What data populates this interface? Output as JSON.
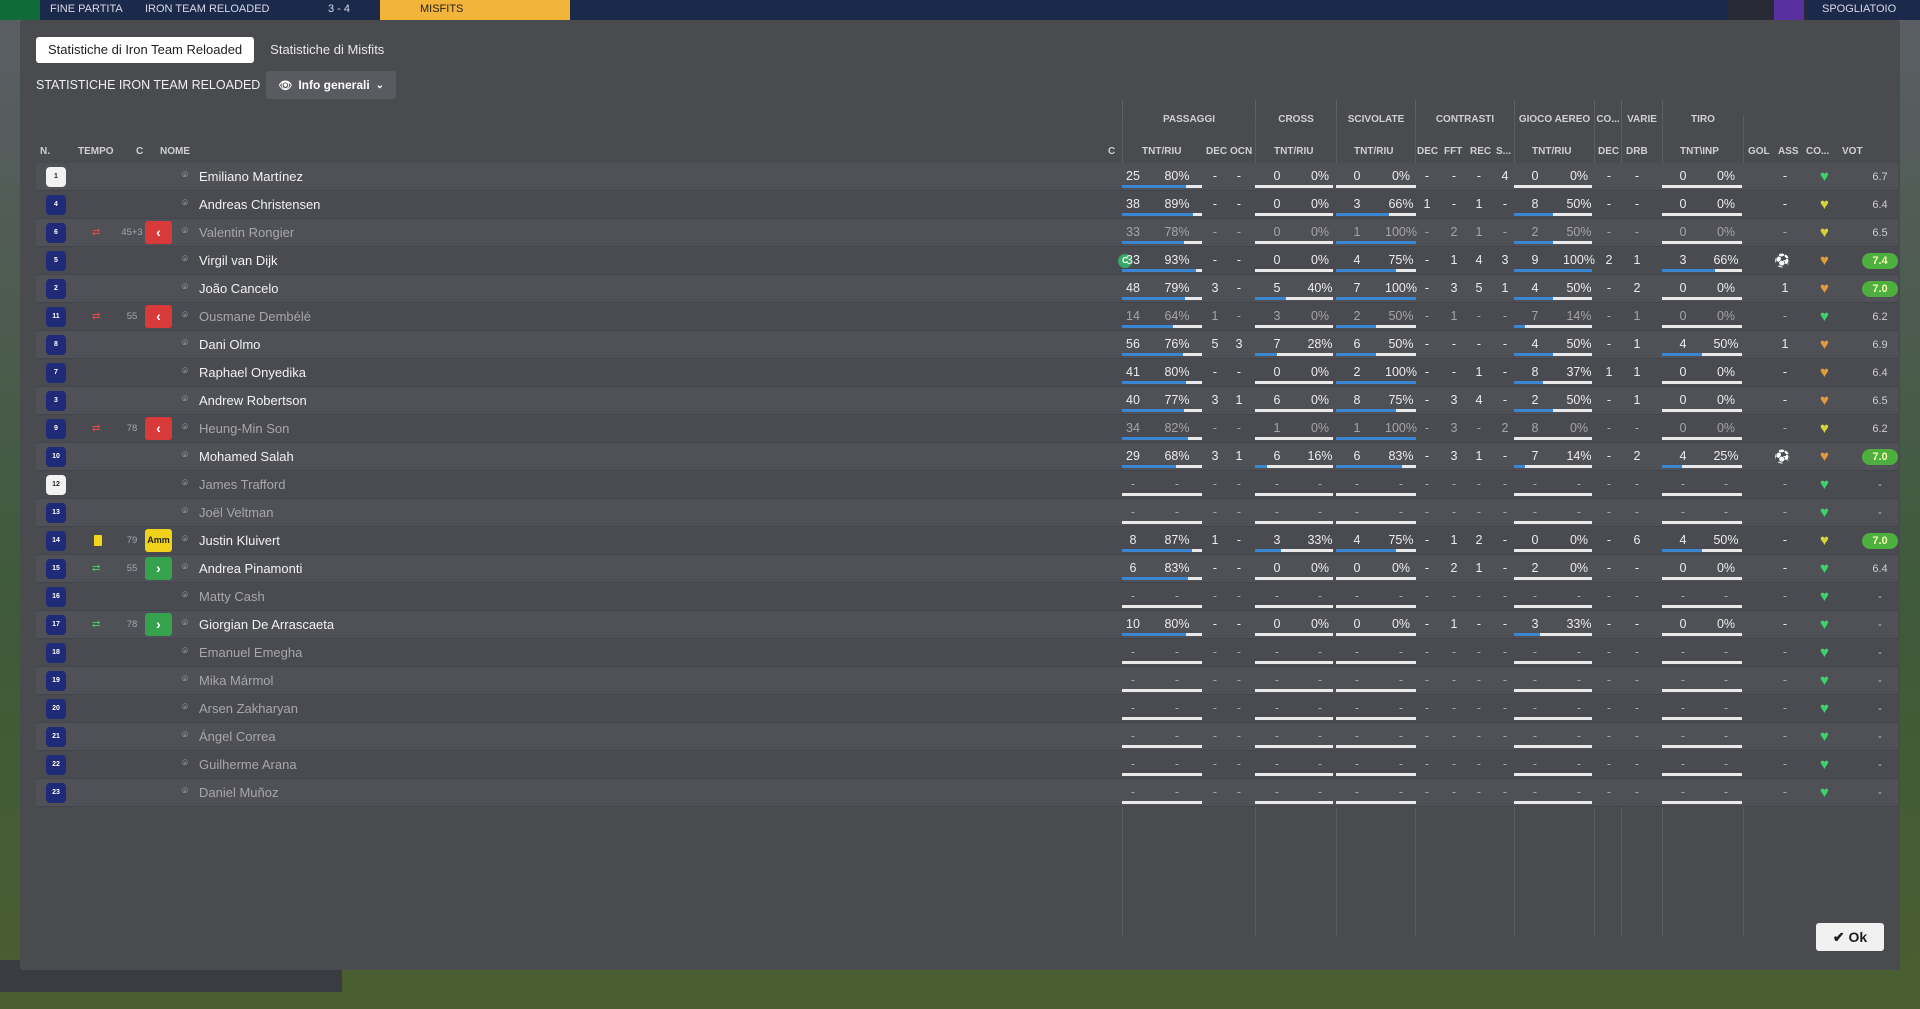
{
  "topbar": {
    "items": [
      "FINE PARTITA",
      "IRON TEAM RELOADED",
      "3 - 4",
      "MISFITS",
      "SPOGLIATOIO"
    ]
  },
  "tabs": [
    {
      "label": "Statistiche di Iron Team Reloaded",
      "active": true
    },
    {
      "label": "Statistiche di Misfits",
      "active": false
    }
  ],
  "subheader": {
    "title": "STATISTICHE IRON TEAM RELOADED",
    "view_label": "Info generali"
  },
  "groups": [
    "PASSAGGI",
    "CROSS",
    "SCIVOLATE",
    "CONTRASTI",
    "GIOCO AEREO",
    "CO...",
    "VARIE",
    "TIRO"
  ],
  "columns": {
    "n": "N.",
    "tempo": "TEMPO",
    "c": "C",
    "nome": "NOME",
    "capt": "C",
    "pass_tr": "TNT/RIU",
    "pass_dec": "DEC",
    "pass_ocn": "OCN",
    "cross_tr": "TNT/RIU",
    "tack_tr": "TNT/RIU",
    "con_dec": "DEC",
    "con_fft": "FFT",
    "con_rec": "REC",
    "con_s": "S...",
    "air_tr": "TNT/RIU",
    "co_dec": "DEC",
    "var_drb": "DRB",
    "shot_tr": "TNT\\INP",
    "gol": "GOL",
    "ass": "ASS",
    "cond": "CO...",
    "vot": "VOT"
  },
  "players": [
    {
      "n": "1",
      "gk": true,
      "name": "Emiliano Martínez",
      "sub": "",
      "tempo": "",
      "cbadge": "",
      "capt": false,
      "muted": false,
      "pass": [
        "25",
        "80%"
      ],
      "pass_dec": "-",
      "pass_ocn": "-",
      "cross": [
        "0",
        "0%"
      ],
      "tack": [
        "0",
        "0%"
      ],
      "con": [
        "-",
        "-",
        "-",
        "4"
      ],
      "air": [
        "0",
        "0%"
      ],
      "co_dec": "-",
      "drb": "-",
      "shot": [
        "0",
        "0%"
      ],
      "gol": "",
      "ass": "-",
      "cond": "green",
      "vot": "6.7",
      "vot_good": false
    },
    {
      "n": "4",
      "gk": false,
      "name": "Andreas Christensen",
      "sub": "",
      "tempo": "",
      "cbadge": "",
      "capt": false,
      "muted": false,
      "pass": [
        "38",
        "89%"
      ],
      "pass_dec": "-",
      "pass_ocn": "-",
      "cross": [
        "0",
        "0%"
      ],
      "tack": [
        "3",
        "66%"
      ],
      "con": [
        "1",
        "-",
        "1",
        "-"
      ],
      "air": [
        "8",
        "50%"
      ],
      "co_dec": "-",
      "drb": "-",
      "shot": [
        "0",
        "0%"
      ],
      "gol": "",
      "ass": "-",
      "cond": "yellow",
      "vot": "6.4",
      "vot_good": false
    },
    {
      "n": "6",
      "gk": false,
      "name": "Valentin Rongier",
      "sub": "out",
      "tempo": "45+3",
      "cbadge": "red",
      "capt": false,
      "muted": true,
      "pass": [
        "33",
        "78%"
      ],
      "pass_dec": "-",
      "pass_ocn": "-",
      "cross": [
        "0",
        "0%"
      ],
      "tack": [
        "1",
        "100%"
      ],
      "con": [
        "-",
        "2",
        "1",
        "-"
      ],
      "air": [
        "2",
        "50%"
      ],
      "co_dec": "-",
      "drb": "-",
      "shot": [
        "0",
        "0%"
      ],
      "gol": "",
      "ass": "-",
      "cond": "yellow",
      "vot": "6.5",
      "vot_good": false
    },
    {
      "n": "5",
      "gk": false,
      "name": "Virgil van Dijk",
      "sub": "",
      "tempo": "",
      "cbadge": "",
      "capt": true,
      "muted": false,
      "pass": [
        "33",
        "93%"
      ],
      "pass_dec": "-",
      "pass_ocn": "-",
      "cross": [
        "0",
        "0%"
      ],
      "tack": [
        "4",
        "75%"
      ],
      "con": [
        "-",
        "1",
        "4",
        "3"
      ],
      "air": [
        "9",
        "100%"
      ],
      "co_dec": "2",
      "drb": "1",
      "shot": [
        "3",
        "66%"
      ],
      "gol": "gear",
      "ass": "-",
      "cond": "orange",
      "vot": "7.4",
      "vot_good": true
    },
    {
      "n": "2",
      "gk": false,
      "name": "João Cancelo",
      "sub": "",
      "tempo": "",
      "cbadge": "",
      "capt": false,
      "muted": false,
      "pass": [
        "48",
        "79%"
      ],
      "pass_dec": "3",
      "pass_ocn": "-",
      "cross": [
        "5",
        "40%"
      ],
      "tack": [
        "7",
        "100%"
      ],
      "con": [
        "-",
        "3",
        "5",
        "1"
      ],
      "air": [
        "4",
        "50%"
      ],
      "co_dec": "-",
      "drb": "2",
      "shot": [
        "0",
        "0%"
      ],
      "gol": "",
      "ass": "1",
      "cond": "orange",
      "vot": "7.0",
      "vot_good": true
    },
    {
      "n": "11",
      "gk": false,
      "name": "Ousmane Dembélé",
      "sub": "out",
      "tempo": "55",
      "cbadge": "red",
      "capt": false,
      "muted": true,
      "pass": [
        "14",
        "64%"
      ],
      "pass_dec": "1",
      "pass_ocn": "-",
      "cross": [
        "3",
        "0%"
      ],
      "tack": [
        "2",
        "50%"
      ],
      "con": [
        "-",
        "1",
        "-",
        "-"
      ],
      "air": [
        "7",
        "14%"
      ],
      "co_dec": "-",
      "drb": "1",
      "shot": [
        "0",
        "0%"
      ],
      "gol": "",
      "ass": "-",
      "cond": "green",
      "vot": "6.2",
      "vot_good": false
    },
    {
      "n": "8",
      "gk": false,
      "name": "Dani Olmo",
      "sub": "",
      "tempo": "",
      "cbadge": "",
      "capt": false,
      "muted": false,
      "pass": [
        "56",
        "76%"
      ],
      "pass_dec": "5",
      "pass_ocn": "3",
      "cross": [
        "7",
        "28%"
      ],
      "tack": [
        "6",
        "50%"
      ],
      "con": [
        "-",
        "-",
        "-",
        "-"
      ],
      "air": [
        "4",
        "50%"
      ],
      "co_dec": "-",
      "drb": "1",
      "shot": [
        "4",
        "50%"
      ],
      "gol": "",
      "ass": "1",
      "cond": "orange",
      "vot": "6.9",
      "vot_good": false
    },
    {
      "n": "7",
      "gk": false,
      "name": "Raphael Onyedika",
      "sub": "",
      "tempo": "",
      "cbadge": "",
      "capt": false,
      "muted": false,
      "pass": [
        "41",
        "80%"
      ],
      "pass_dec": "-",
      "pass_ocn": "-",
      "cross": [
        "0",
        "0%"
      ],
      "tack": [
        "2",
        "100%"
      ],
      "con": [
        "-",
        "-",
        "1",
        "-"
      ],
      "air": [
        "8",
        "37%"
      ],
      "co_dec": "1",
      "drb": "1",
      "shot": [
        "0",
        "0%"
      ],
      "gol": "",
      "ass": "-",
      "cond": "orange",
      "vot": "6.4",
      "vot_good": false
    },
    {
      "n": "3",
      "gk": false,
      "name": "Andrew Robertson",
      "sub": "",
      "tempo": "",
      "cbadge": "",
      "capt": false,
      "muted": false,
      "pass": [
        "40",
        "77%"
      ],
      "pass_dec": "3",
      "pass_ocn": "1",
      "cross": [
        "6",
        "0%"
      ],
      "tack": [
        "8",
        "75%"
      ],
      "con": [
        "-",
        "3",
        "4",
        "-"
      ],
      "air": [
        "2",
        "50%"
      ],
      "co_dec": "-",
      "drb": "1",
      "shot": [
        "0",
        "0%"
      ],
      "gol": "",
      "ass": "-",
      "cond": "orange",
      "vot": "6.5",
      "vot_good": false
    },
    {
      "n": "9",
      "gk": false,
      "name": "Heung-Min Son",
      "sub": "out",
      "tempo": "78",
      "cbadge": "red",
      "capt": false,
      "muted": true,
      "pass": [
        "34",
        "82%"
      ],
      "pass_dec": "-",
      "pass_ocn": "-",
      "cross": [
        "1",
        "0%"
      ],
      "tack": [
        "1",
        "100%"
      ],
      "con": [
        "-",
        "3",
        "-",
        "2"
      ],
      "air": [
        "8",
        "0%"
      ],
      "co_dec": "-",
      "drb": "-",
      "shot": [
        "0",
        "0%"
      ],
      "gol": "",
      "ass": "-",
      "cond": "yellow",
      "vot": "6.2",
      "vot_good": false
    },
    {
      "n": "10",
      "gk": false,
      "name": "Mohamed Salah",
      "sub": "",
      "tempo": "",
      "cbadge": "",
      "capt": false,
      "muted": false,
      "pass": [
        "29",
        "68%"
      ],
      "pass_dec": "3",
      "pass_ocn": "1",
      "cross": [
        "6",
        "16%"
      ],
      "tack": [
        "6",
        "83%"
      ],
      "con": [
        "-",
        "3",
        "1",
        "-"
      ],
      "air": [
        "7",
        "14%"
      ],
      "co_dec": "-",
      "drb": "2",
      "shot": [
        "4",
        "25%"
      ],
      "gol": "gear",
      "ass": "-",
      "cond": "orange",
      "vot": "7.0",
      "vot_good": true
    },
    {
      "n": "12",
      "gk": true,
      "name": "James Trafford",
      "sub": "",
      "tempo": "",
      "cbadge": "",
      "capt": false,
      "muted": true,
      "pass": [
        "-",
        "-"
      ],
      "pass_dec": "-",
      "pass_ocn": "-",
      "cross": [
        "-",
        "-"
      ],
      "tack": [
        "-",
        "-"
      ],
      "con": [
        "-",
        "-",
        "-",
        "-"
      ],
      "air": [
        "-",
        "-"
      ],
      "co_dec": "-",
      "drb": "-",
      "shot": [
        "-",
        "-"
      ],
      "gol": "",
      "ass": "-",
      "cond": "green",
      "vot": "-",
      "vot_good": false
    },
    {
      "n": "13",
      "gk": false,
      "name": "Joël Veltman",
      "sub": "",
      "tempo": "",
      "cbadge": "",
      "capt": false,
      "muted": true,
      "pass": [
        "-",
        "-"
      ],
      "pass_dec": "-",
      "pass_ocn": "-",
      "cross": [
        "-",
        "-"
      ],
      "tack": [
        "-",
        "-"
      ],
      "con": [
        "-",
        "-",
        "-",
        "-"
      ],
      "air": [
        "-",
        "-"
      ],
      "co_dec": "-",
      "drb": "-",
      "shot": [
        "-",
        "-"
      ],
      "gol": "",
      "ass": "-",
      "cond": "green",
      "vot": "-",
      "vot_good": false
    },
    {
      "n": "14",
      "gk": false,
      "name": "Justin Kluivert",
      "sub": "yellow",
      "tempo": "79",
      "cbadge": "amm",
      "capt": false,
      "muted": false,
      "pass": [
        "8",
        "87%"
      ],
      "pass_dec": "1",
      "pass_ocn": "-",
      "cross": [
        "3",
        "33%"
      ],
      "tack": [
        "4",
        "75%"
      ],
      "con": [
        "-",
        "1",
        "2",
        "-"
      ],
      "air": [
        "0",
        "0%"
      ],
      "co_dec": "-",
      "drb": "6",
      "shot": [
        "4",
        "50%"
      ],
      "gol": "",
      "ass": "-",
      "cond": "yellow",
      "vot": "7.0",
      "vot_good": true
    },
    {
      "n": "15",
      "gk": false,
      "name": "Andrea Pinamonti",
      "sub": "in",
      "tempo": "55",
      "cbadge": "green",
      "capt": false,
      "muted": false,
      "pass": [
        "6",
        "83%"
      ],
      "pass_dec": "-",
      "pass_ocn": "-",
      "cross": [
        "0",
        "0%"
      ],
      "tack": [
        "0",
        "0%"
      ],
      "con": [
        "-",
        "2",
        "1",
        "-"
      ],
      "air": [
        "2",
        "0%"
      ],
      "co_dec": "-",
      "drb": "-",
      "shot": [
        "0",
        "0%"
      ],
      "gol": "",
      "ass": "-",
      "cond": "green",
      "vot": "6.4",
      "vot_good": false
    },
    {
      "n": "16",
      "gk": false,
      "name": "Matty Cash",
      "sub": "",
      "tempo": "",
      "cbadge": "",
      "capt": false,
      "muted": true,
      "pass": [
        "-",
        "-"
      ],
      "pass_dec": "-",
      "pass_ocn": "-",
      "cross": [
        "-",
        "-"
      ],
      "tack": [
        "-",
        "-"
      ],
      "con": [
        "-",
        "-",
        "-",
        "-"
      ],
      "air": [
        "-",
        "-"
      ],
      "co_dec": "-",
      "drb": "-",
      "shot": [
        "-",
        "-"
      ],
      "gol": "",
      "ass": "-",
      "cond": "green",
      "vot": "-",
      "vot_good": false
    },
    {
      "n": "17",
      "gk": false,
      "name": "Giorgian De Arrascaeta",
      "sub": "in",
      "tempo": "78",
      "cbadge": "green",
      "capt": false,
      "muted": false,
      "pass": [
        "10",
        "80%"
      ],
      "pass_dec": "-",
      "pass_ocn": "-",
      "cross": [
        "0",
        "0%"
      ],
      "tack": [
        "0",
        "0%"
      ],
      "con": [
        "-",
        "1",
        "-",
        "-"
      ],
      "air": [
        "3",
        "33%"
      ],
      "co_dec": "-",
      "drb": "-",
      "shot": [
        "0",
        "0%"
      ],
      "gol": "",
      "ass": "-",
      "cond": "green",
      "vot": "-",
      "vot_good": false
    },
    {
      "n": "18",
      "gk": false,
      "name": "Emanuel Emegha",
      "sub": "",
      "tempo": "",
      "cbadge": "",
      "capt": false,
      "muted": true,
      "pass": [
        "-",
        "-"
      ],
      "pass_dec": "-",
      "pass_ocn": "-",
      "cross": [
        "-",
        "-"
      ],
      "tack": [
        "-",
        "-"
      ],
      "con": [
        "-",
        "-",
        "-",
        "-"
      ],
      "air": [
        "-",
        "-"
      ],
      "co_dec": "-",
      "drb": "-",
      "shot": [
        "-",
        "-"
      ],
      "gol": "",
      "ass": "-",
      "cond": "green",
      "vot": "-",
      "vot_good": false
    },
    {
      "n": "19",
      "gk": false,
      "name": "Mika Mármol",
      "sub": "",
      "tempo": "",
      "cbadge": "",
      "capt": false,
      "muted": true,
      "pass": [
        "-",
        "-"
      ],
      "pass_dec": "-",
      "pass_ocn": "-",
      "cross": [
        "-",
        "-"
      ],
      "tack": [
        "-",
        "-"
      ],
      "con": [
        "-",
        "-",
        "-",
        "-"
      ],
      "air": [
        "-",
        "-"
      ],
      "co_dec": "-",
      "drb": "-",
      "shot": [
        "-",
        "-"
      ],
      "gol": "",
      "ass": "-",
      "cond": "green",
      "vot": "-",
      "vot_good": false
    },
    {
      "n": "20",
      "gk": false,
      "name": "Arsen Zakharyan",
      "sub": "",
      "tempo": "",
      "cbadge": "",
      "capt": false,
      "muted": true,
      "pass": [
        "-",
        "-"
      ],
      "pass_dec": "-",
      "pass_ocn": "-",
      "cross": [
        "-",
        "-"
      ],
      "tack": [
        "-",
        "-"
      ],
      "con": [
        "-",
        "-",
        "-",
        "-"
      ],
      "air": [
        "-",
        "-"
      ],
      "co_dec": "-",
      "drb": "-",
      "shot": [
        "-",
        "-"
      ],
      "gol": "",
      "ass": "-",
      "cond": "green",
      "vot": "-",
      "vot_good": false
    },
    {
      "n": "21",
      "gk": false,
      "name": "Ángel Correa",
      "sub": "",
      "tempo": "",
      "cbadge": "",
      "capt": false,
      "muted": true,
      "pass": [
        "-",
        "-"
      ],
      "pass_dec": "-",
      "pass_ocn": "-",
      "cross": [
        "-",
        "-"
      ],
      "tack": [
        "-",
        "-"
      ],
      "con": [
        "-",
        "-",
        "-",
        "-"
      ],
      "air": [
        "-",
        "-"
      ],
      "co_dec": "-",
      "drb": "-",
      "shot": [
        "-",
        "-"
      ],
      "gol": "",
      "ass": "-",
      "cond": "green",
      "vot": "-",
      "vot_good": false
    },
    {
      "n": "22",
      "gk": false,
      "name": "Guilherme Arana",
      "sub": "",
      "tempo": "",
      "cbadge": "",
      "capt": false,
      "muted": true,
      "pass": [
        "-",
        "-"
      ],
      "pass_dec": "-",
      "pass_ocn": "-",
      "cross": [
        "-",
        "-"
      ],
      "tack": [
        "-",
        "-"
      ],
      "con": [
        "-",
        "-",
        "-",
        "-"
      ],
      "air": [
        "-",
        "-"
      ],
      "co_dec": "-",
      "drb": "-",
      "shot": [
        "-",
        "-"
      ],
      "gol": "",
      "ass": "-",
      "cond": "green",
      "vot": "-",
      "vot_good": false
    },
    {
      "n": "23",
      "gk": false,
      "name": "Daniel Muñoz",
      "sub": "",
      "tempo": "",
      "cbadge": "",
      "capt": false,
      "muted": true,
      "pass": [
        "-",
        "-"
      ],
      "pass_dec": "-",
      "pass_ocn": "-",
      "cross": [
        "-",
        "-"
      ],
      "tack": [
        "-",
        "-"
      ],
      "con": [
        "-",
        "-",
        "-",
        "-"
      ],
      "air": [
        "-",
        "-"
      ],
      "co_dec": "-",
      "drb": "-",
      "shot": [
        "-",
        "-"
      ],
      "gol": "",
      "ass": "-",
      "cond": "green",
      "vot": "-",
      "vot_good": false
    }
  ],
  "colors": {
    "accent_bar": "#3b86d2",
    "rating_good": "#4caf3e",
    "sub_out": "#d83a3a",
    "sub_in": "#35a34e",
    "card_yellow": "#f1d11a"
  },
  "ok_label": "Ok"
}
